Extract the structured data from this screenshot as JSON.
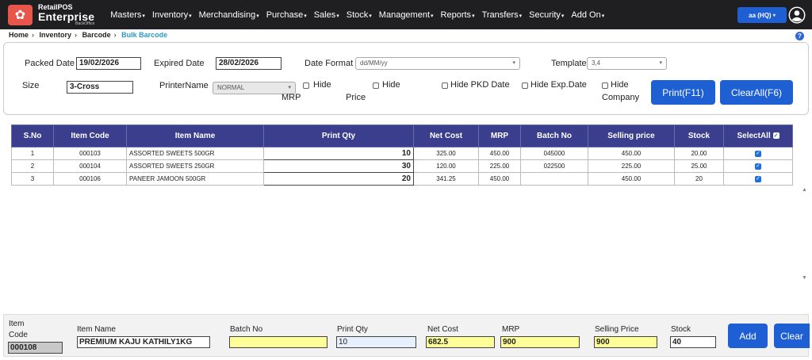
{
  "app": {
    "logo_line1": "RetailPOS",
    "logo_line2": "Enterprise",
    "logo_line3": "BackOffice",
    "store_label": "aa (HQ)"
  },
  "menu": [
    "Masters",
    "Inventory",
    "Merchandising",
    "Purchase",
    "Sales",
    "Stock",
    "Management",
    "Reports",
    "Transfers",
    "Security",
    "Add On"
  ],
  "breadcrumb": [
    "Home",
    "Inventory",
    "Barcode",
    "Bulk Barcode"
  ],
  "form": {
    "packed_date_label": "Packed Date",
    "packed_date": "19/02/2026",
    "expired_date_label": "Expired Date",
    "expired_date": "28/02/2026",
    "date_format_label": "Date Format",
    "date_format": "dd/MM/yy",
    "template_label": "Template",
    "template": "3,4",
    "size_label": "Size",
    "size": "3-Cross",
    "printer_label": "PrinterName",
    "printer": "NORMAL",
    "hide_mrp_1": "Hide",
    "hide_mrp_2": "MRP",
    "hide_price_1": "Hide",
    "hide_price_2": "Price",
    "hide_pkd": "Hide PKD Date",
    "hide_exp": "Hide Exp.Date",
    "hide_company_1": "Hide",
    "hide_company_2": "Company",
    "print_button": "Print(F11)",
    "clear_all_button": "ClearAll(F6)"
  },
  "table": {
    "headers": [
      "S.No",
      "Item Code",
      "Item Name",
      "Print Qty",
      "Net Cost",
      "MRP",
      "Batch No",
      "Selling price",
      "Stock",
      "SelectAll"
    ],
    "rows": [
      {
        "sno": "1",
        "code": "000103",
        "name": "ASSORTED SWEETS 500GR",
        "qty": "10",
        "net": "325.00",
        "mrp": "450.00",
        "batch": "045000",
        "selling": "450.00",
        "stock": "20.00",
        "checked": true
      },
      {
        "sno": "2",
        "code": "000104",
        "name": "ASSORTED SWEETS 250GR",
        "qty": "30",
        "net": "120.00",
        "mrp": "225.00",
        "batch": "022500",
        "selling": "225.00",
        "stock": "25.00",
        "checked": true
      },
      {
        "sno": "3",
        "code": "000106",
        "name": "PANEER JAMOON 500GR",
        "qty": "20",
        "net": "341.25",
        "mrp": "450.00",
        "batch": "",
        "selling": "450.00",
        "stock": "20",
        "checked": true
      }
    ]
  },
  "entry": {
    "item_code_label_1": "Item",
    "item_code_label_2": "Code",
    "item_code": "000108",
    "item_name_label": "Item Name",
    "item_name": "PREMIUM KAJU KATHILY1KG",
    "batch_label": "Batch No",
    "batch": "",
    "qty_label": "Print Qty",
    "qty": "10",
    "net_label": "Net Cost",
    "net": "682.5",
    "mrp_label": "MRP",
    "mrp": "900",
    "selling_label": "Selling Price",
    "selling": "900",
    "stock_label": "Stock",
    "stock": "40",
    "add_button": "Add",
    "clear_button": "Clear"
  },
  "colors": {
    "nav_bg": "#1f1f21",
    "logo_accent": "#e8554b",
    "primary_button": "#1f5fd4",
    "table_header": "#3b3e8c",
    "breadcrumb_active": "#2a9bc4",
    "input_highlight": "#ffff99"
  }
}
